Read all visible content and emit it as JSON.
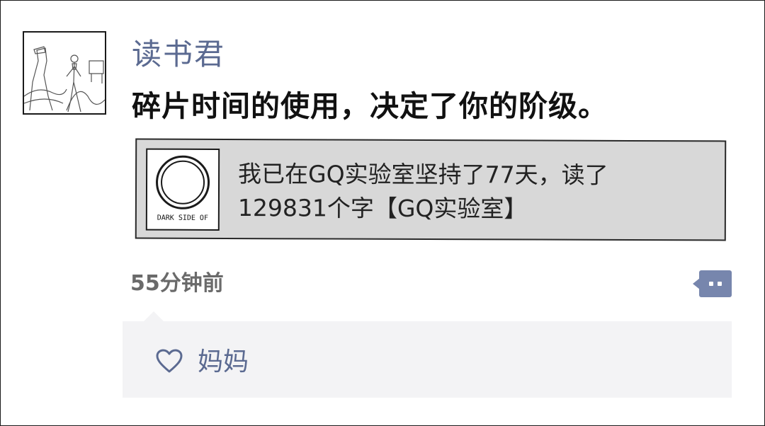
{
  "post": {
    "author": "读书君",
    "text": "碎片时间的使用，决定了你的阶级。",
    "time": "55分钟前"
  },
  "link_card": {
    "title": "我已在GQ实验室坚持了77天，读了129831个字【GQ实验室】",
    "thumb_label": "DARK SIDE OF",
    "background": "#d8d8d8"
  },
  "likes": {
    "icon": "heart-outline-icon",
    "names": "妈妈"
  },
  "actions": {
    "comment_icon": "comment-bubble-icon"
  },
  "colors": {
    "name": "#5b6a91",
    "accent": "#7786ad",
    "likes_bg": "#f3f3f5"
  }
}
